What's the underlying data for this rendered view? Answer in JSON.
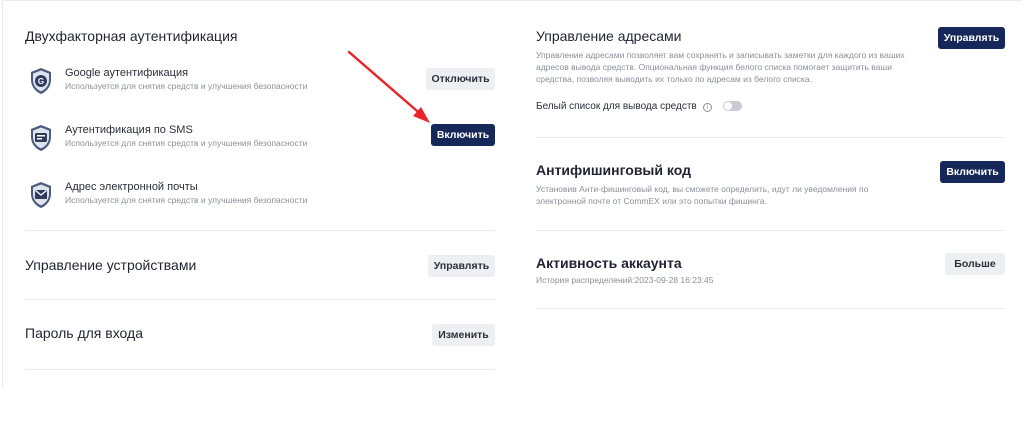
{
  "two_factor": {
    "title": "Двухфакторная аутентификация",
    "methods": [
      {
        "name": "Google аутентификация",
        "desc": "Используется для снятия средств и улучшения безопасности",
        "button": "Отключить",
        "icon": "google-auth-shield-icon"
      },
      {
        "name": "Аутентификация по SMS",
        "desc": "Используется для снятия средств и улучшения безопасности",
        "button": "Включить",
        "icon": "sms-shield-icon"
      },
      {
        "name": "Адрес электронной почты",
        "desc": "Используется для снятия средств и улучшения безопасности",
        "icon": "email-shield-icon"
      }
    ]
  },
  "devices": {
    "title": "Управление устройствами",
    "button": "Управлять"
  },
  "login_password": {
    "title": "Пароль для входа",
    "button": "Изменить"
  },
  "address_management": {
    "title": "Управление адресами",
    "desc": "Управление адресами позволяет вам сохранять и записывать заметки для каждого из ваших адресов вывода средств. Опциональная функция белого списка помогает защитить ваши средства, позволяя выводить их только по адресам из белого списка.",
    "button": "Управлять",
    "whitelist_label": "Белый список для вывода средств",
    "whitelist_on": false
  },
  "anti_phishing": {
    "title": "Антифишинговый код",
    "desc": "Установив Анти-фишинговый код, вы сможете определить, идут ли уведомления по электронной почте от CommEX или это попытки фишинга.",
    "button": "Включить"
  },
  "account_activity": {
    "title": "Активность аккаунта",
    "history": "История распределений:2023-09-28 16:23:45",
    "button": "Больше"
  },
  "colors": {
    "primary_button": "#16285a",
    "secondary_button": "#eeeff2",
    "annotation_arrow": "#e8242a"
  }
}
